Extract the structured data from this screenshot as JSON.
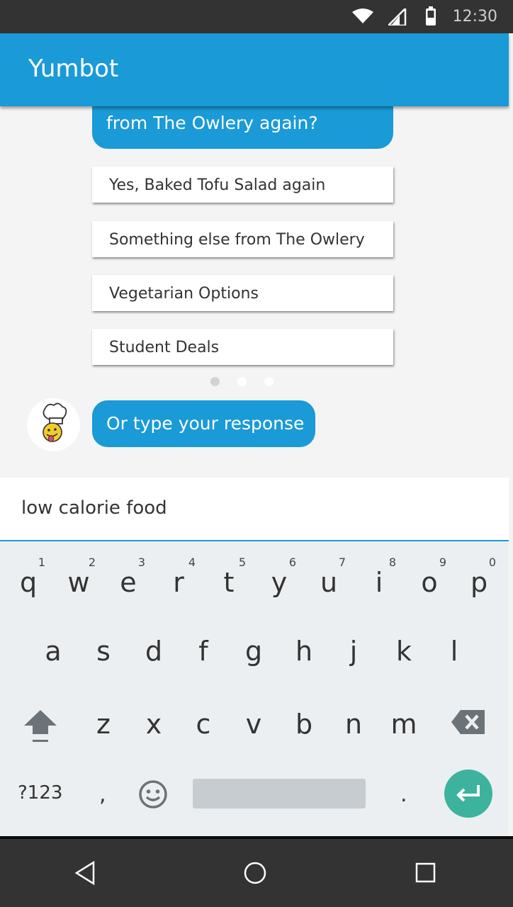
{
  "status_bar": {
    "time": "12:30"
  },
  "app_bar": {
    "title": "Yumbot"
  },
  "chat": {
    "bot_message": "from The Owlery again?",
    "options": [
      "Yes, Baked Tofu Salad again",
      "Something else from The Owlery",
      "Vegetarian Options",
      "Student Deals"
    ],
    "page_dots": {
      "count": 3,
      "active": 1
    },
    "prompt_bubble": "Or type your response"
  },
  "input": {
    "value": "low calorie food"
  },
  "keyboard": {
    "row1": [
      {
        "k": "q",
        "n": "1"
      },
      {
        "k": "w",
        "n": "2"
      },
      {
        "k": "e",
        "n": "3"
      },
      {
        "k": "r",
        "n": "4"
      },
      {
        "k": "t",
        "n": "5"
      },
      {
        "k": "y",
        "n": "6"
      },
      {
        "k": "u",
        "n": "7"
      },
      {
        "k": "i",
        "n": "8"
      },
      {
        "k": "o",
        "n": "9"
      },
      {
        "k": "p",
        "n": "0"
      }
    ],
    "row2": [
      "a",
      "s",
      "d",
      "f",
      "g",
      "h",
      "j",
      "k",
      "l"
    ],
    "row3": [
      "z",
      "x",
      "c",
      "v",
      "b",
      "n",
      "m"
    ],
    "symbols_key": "?123",
    "comma_key": ",",
    "period_key": "."
  },
  "colors": {
    "accent": "#1a9ad6",
    "enter": "#3db39e",
    "dark": "#333333"
  }
}
